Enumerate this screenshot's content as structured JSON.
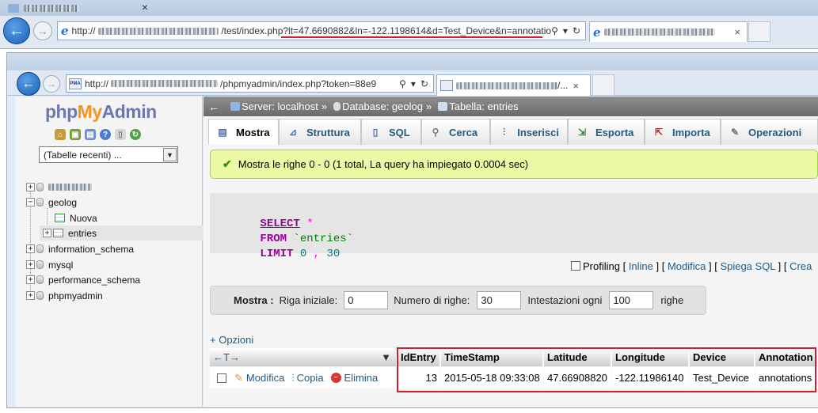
{
  "outer_browser": {
    "url_prefix": "http://",
    "url_suffix": "/test/index.php?lt=47.6690882&ln=-122.1198614&d=Test_Device&n=annotatio",
    "tab_close": "×"
  },
  "inner_browser": {
    "url_prefix": "http://",
    "url_suffix": "/phpmyadmin/index.php?token=88e9",
    "tab_label": "/...",
    "tab_close": "×",
    "favicon_text": "PMA"
  },
  "sidebar": {
    "logo_php": "php",
    "logo_my": "My",
    "logo_admin": "Admin",
    "recent_tables": "(Tabelle recenti) ...",
    "tree": {
      "geolog": "geolog",
      "nuova": "Nuova",
      "entries": "entries",
      "information_schema": "information_schema",
      "mysql": "mysql",
      "performance_schema": "performance_schema",
      "phpmyadmin": "phpmyadmin"
    }
  },
  "breadcrumb": {
    "server": "Server: localhost",
    "sep": "»",
    "database": "Database: geolog",
    "table": "Tabella: entries"
  },
  "tabs": [
    "Mostra",
    "Struttura",
    "SQL",
    "Cerca",
    "Inserisci",
    "Esporta",
    "Importa",
    "Operazioni"
  ],
  "success_message": "Mostra le righe 0 - 0 (1 total, La query ha impiegato 0.0004 sec)",
  "sql": {
    "select": "SELECT",
    "star": "*",
    "from": "FROM",
    "table": "`entries`",
    "limit": "LIMIT",
    "offset": "0",
    "comma": ",",
    "count": "30"
  },
  "sql_links": {
    "profiling": "Profiling",
    "inline": "Inline",
    "modifica": "Modifica",
    "spiega": "Spiega SQL",
    "crea": "Crea"
  },
  "navigation": {
    "mostra_label": "Mostra :",
    "riga_iniziale_label": "Riga iniziale:",
    "riga_iniziale_value": "0",
    "numero_righe_label": "Numero di righe:",
    "numero_righe_value": "30",
    "intestazioni_label": "Intestazioni ogni",
    "intestazioni_value": "100",
    "righe_label": "righe"
  },
  "options_link": "+ Opzioni",
  "results": {
    "columns": [
      "IdEntry",
      "TimeStamp",
      "Latitude",
      "Longitude",
      "Device",
      "Annotation"
    ],
    "row": [
      "13",
      "2015-05-18 09:33:08",
      "47.66908820",
      "-122.11986140",
      "Test_Device",
      "annotations"
    ],
    "actions": {
      "edit": "Modifica",
      "copy": "Copia",
      "delete": "Elimina"
    },
    "arrows": "←T→"
  }
}
